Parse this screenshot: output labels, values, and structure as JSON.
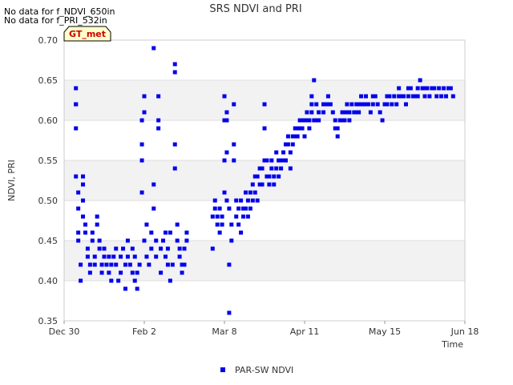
{
  "notes": [
    "No data for f_NDVI_650in",
    "No data for f_PRI_532in"
  ],
  "badge": "GT_met",
  "colors": {
    "series": "#0000ee",
    "band": "#f2f2f2",
    "grid": "#dddddd",
    "badge_bg": "#ffffcc"
  },
  "chart_data": {
    "type": "scatter",
    "title": "SRS NDVI and PRI",
    "xlabel": "Time",
    "ylabel": "NDVI, PRI",
    "ylim": [
      0.35,
      0.7
    ],
    "y_ticks": [
      "0.35",
      "0.40",
      "0.45",
      "0.50",
      "0.55",
      "0.60",
      "0.65",
      "0.70"
    ],
    "x_axis_dates": [
      "Dec 30",
      "Feb 2",
      "Mar 8",
      "Apr 11",
      "May 15",
      "Jun 18"
    ],
    "xlim_days_from_dec30": [
      0,
      170
    ],
    "grid": "horizontal bands",
    "legend": "bottom-center",
    "series": [
      {
        "name": "PAR-SW NDVI",
        "points_day_value": [
          [
            5,
            0.64
          ],
          [
            5,
            0.62
          ],
          [
            5,
            0.62
          ],
          [
            5,
            0.59
          ],
          [
            5,
            0.53
          ],
          [
            6,
            0.51
          ],
          [
            6,
            0.49
          ],
          [
            6,
            0.46
          ],
          [
            6,
            0.45
          ],
          [
            7,
            0.42
          ],
          [
            7,
            0.4
          ],
          [
            8,
            0.53
          ],
          [
            8,
            0.52
          ],
          [
            8,
            0.5
          ],
          [
            8,
            0.48
          ],
          [
            9,
            0.47
          ],
          [
            9,
            0.46
          ],
          [
            10,
            0.44
          ],
          [
            10,
            0.43
          ],
          [
            11,
            0.42
          ],
          [
            11,
            0.41
          ],
          [
            12,
            0.46
          ],
          [
            12,
            0.45
          ],
          [
            13,
            0.43
          ],
          [
            13,
            0.42
          ],
          [
            14,
            0.47
          ],
          [
            14,
            0.48
          ],
          [
            15,
            0.45
          ],
          [
            15,
            0.44
          ],
          [
            16,
            0.42
          ],
          [
            16,
            0.41
          ],
          [
            17,
            0.43
          ],
          [
            17,
            0.44
          ],
          [
            18,
            0.42
          ],
          [
            19,
            0.43
          ],
          [
            19,
            0.41
          ],
          [
            20,
            0.4
          ],
          [
            20,
            0.42
          ],
          [
            21,
            0.43
          ],
          [
            22,
            0.42
          ],
          [
            22,
            0.44
          ],
          [
            23,
            0.4
          ],
          [
            24,
            0.43
          ],
          [
            24,
            0.41
          ],
          [
            25,
            0.44
          ],
          [
            26,
            0.42
          ],
          [
            26,
            0.39
          ],
          [
            27,
            0.43
          ],
          [
            27,
            0.45
          ],
          [
            28,
            0.42
          ],
          [
            29,
            0.41
          ],
          [
            29,
            0.44
          ],
          [
            30,
            0.43
          ],
          [
            30,
            0.4
          ],
          [
            31,
            0.41
          ],
          [
            31,
            0.39
          ],
          [
            32,
            0.42
          ],
          [
            33,
            0.6
          ],
          [
            33,
            0.57
          ],
          [
            33,
            0.55
          ],
          [
            33,
            0.51
          ],
          [
            34,
            0.63
          ],
          [
            34,
            0.61
          ],
          [
            34,
            0.61
          ],
          [
            34,
            0.45
          ],
          [
            35,
            0.47
          ],
          [
            35,
            0.43
          ],
          [
            36,
            0.42
          ],
          [
            37,
            0.46
          ],
          [
            37,
            0.44
          ],
          [
            38,
            0.69
          ],
          [
            38,
            0.52
          ],
          [
            38,
            0.49
          ],
          [
            39,
            0.45
          ],
          [
            39,
            0.43
          ],
          [
            40,
            0.63
          ],
          [
            40,
            0.6
          ],
          [
            40,
            0.59
          ],
          [
            41,
            0.44
          ],
          [
            41,
            0.41
          ],
          [
            42,
            0.45
          ],
          [
            43,
            0.46
          ],
          [
            43,
            0.43
          ],
          [
            44,
            0.44
          ],
          [
            44,
            0.42
          ],
          [
            45,
            0.46
          ],
          [
            45,
            0.4
          ],
          [
            46,
            0.42
          ],
          [
            47,
            0.67
          ],
          [
            47,
            0.66
          ],
          [
            47,
            0.57
          ],
          [
            47,
            0.54
          ],
          [
            48,
            0.47
          ],
          [
            48,
            0.45
          ],
          [
            49,
            0.44
          ],
          [
            49,
            0.43
          ],
          [
            50,
            0.42
          ],
          [
            50,
            0.41
          ],
          [
            51,
            0.44
          ],
          [
            51,
            0.42
          ],
          [
            52,
            0.45
          ],
          [
            52,
            0.46
          ],
          [
            63,
            0.48
          ],
          [
            63,
            0.44
          ],
          [
            64,
            0.5
          ],
          [
            64,
            0.49
          ],
          [
            65,
            0.48
          ],
          [
            65,
            0.47
          ],
          [
            66,
            0.49
          ],
          [
            66,
            0.46
          ],
          [
            67,
            0.48
          ],
          [
            67,
            0.47
          ],
          [
            68,
            0.63
          ],
          [
            68,
            0.6
          ],
          [
            68,
            0.55
          ],
          [
            68,
            0.51
          ],
          [
            69,
            0.61
          ],
          [
            69,
            0.6
          ],
          [
            69,
            0.56
          ],
          [
            69,
            0.5
          ],
          [
            70,
            0.49
          ],
          [
            70,
            0.42
          ],
          [
            70,
            0.36
          ],
          [
            71,
            0.45
          ],
          [
            71,
            0.47
          ],
          [
            72,
            0.62
          ],
          [
            72,
            0.57
          ],
          [
            72,
            0.55
          ],
          [
            73,
            0.48
          ],
          [
            73,
            0.5
          ],
          [
            74,
            0.49
          ],
          [
            74,
            0.47
          ],
          [
            75,
            0.5
          ],
          [
            75,
            0.46
          ],
          [
            76,
            0.48
          ],
          [
            76,
            0.49
          ],
          [
            77,
            0.49
          ],
          [
            77,
            0.51
          ],
          [
            78,
            0.48
          ],
          [
            78,
            0.5
          ],
          [
            79,
            0.51
          ],
          [
            79,
            0.49
          ],
          [
            80,
            0.52
          ],
          [
            80,
            0.5
          ],
          [
            81,
            0.53
          ],
          [
            81,
            0.51
          ],
          [
            82,
            0.53
          ],
          [
            82,
            0.5
          ],
          [
            83,
            0.52
          ],
          [
            83,
            0.54
          ],
          [
            84,
            0.54
          ],
          [
            84,
            0.52
          ],
          [
            85,
            0.62
          ],
          [
            85,
            0.59
          ],
          [
            85,
            0.55
          ],
          [
            86,
            0.53
          ],
          [
            86,
            0.55
          ],
          [
            87,
            0.53
          ],
          [
            87,
            0.52
          ],
          [
            88,
            0.54
          ],
          [
            88,
            0.55
          ],
          [
            89,
            0.53
          ],
          [
            89,
            0.52
          ],
          [
            90,
            0.54
          ],
          [
            90,
            0.56
          ],
          [
            91,
            0.55
          ],
          [
            91,
            0.53
          ],
          [
            92,
            0.55
          ],
          [
            92,
            0.54
          ],
          [
            93,
            0.56
          ],
          [
            93,
            0.55
          ],
          [
            94,
            0.57
          ],
          [
            94,
            0.55
          ],
          [
            95,
            0.58
          ],
          [
            95,
            0.57
          ],
          [
            96,
            0.56
          ],
          [
            96,
            0.54
          ],
          [
            97,
            0.58
          ],
          [
            97,
            0.57
          ],
          [
            98,
            0.58
          ],
          [
            98,
            0.59
          ],
          [
            99,
            0.59
          ],
          [
            99,
            0.58
          ],
          [
            100,
            0.6
          ],
          [
            100,
            0.59
          ],
          [
            101,
            0.6
          ],
          [
            101,
            0.59
          ],
          [
            102,
            0.6
          ],
          [
            102,
            0.58
          ],
          [
            103,
            0.61
          ],
          [
            103,
            0.6
          ],
          [
            104,
            0.6
          ],
          [
            104,
            0.59
          ],
          [
            105,
            0.63
          ],
          [
            105,
            0.62
          ],
          [
            105,
            0.61
          ],
          [
            106,
            0.65
          ],
          [
            106,
            0.6
          ],
          [
            107,
            0.62
          ],
          [
            107,
            0.6
          ],
          [
            108,
            0.61
          ],
          [
            108,
            0.6
          ],
          [
            110,
            0.62
          ],
          [
            110,
            0.61
          ],
          [
            111,
            0.62
          ],
          [
            112,
            0.63
          ],
          [
            112,
            0.62
          ],
          [
            113,
            0.62
          ],
          [
            114,
            0.61
          ],
          [
            115,
            0.6
          ],
          [
            115,
            0.59
          ],
          [
            116,
            0.59
          ],
          [
            116,
            0.58
          ],
          [
            117,
            0.6
          ],
          [
            118,
            0.61
          ],
          [
            118,
            0.6
          ],
          [
            119,
            0.61
          ],
          [
            119,
            0.6
          ],
          [
            120,
            0.62
          ],
          [
            120,
            0.61
          ],
          [
            121,
            0.61
          ],
          [
            121,
            0.6
          ],
          [
            122,
            0.62
          ],
          [
            123,
            0.61
          ],
          [
            124,
            0.62
          ],
          [
            124,
            0.61
          ],
          [
            125,
            0.62
          ],
          [
            125,
            0.61
          ],
          [
            126,
            0.62
          ],
          [
            126,
            0.63
          ],
          [
            127,
            0.62
          ],
          [
            128,
            0.63
          ],
          [
            128,
            0.62
          ],
          [
            129,
            0.62
          ],
          [
            130,
            0.61
          ],
          [
            131,
            0.63
          ],
          [
            131,
            0.62
          ],
          [
            132,
            0.63
          ],
          [
            133,
            0.62
          ],
          [
            134,
            0.61
          ],
          [
            135,
            0.6
          ],
          [
            136,
            0.62
          ],
          [
            137,
            0.62
          ],
          [
            137,
            0.63
          ],
          [
            138,
            0.63
          ],
          [
            139,
            0.62
          ],
          [
            140,
            0.63
          ],
          [
            141,
            0.62
          ],
          [
            142,
            0.63
          ],
          [
            142,
            0.64
          ],
          [
            143,
            0.63
          ],
          [
            144,
            0.63
          ],
          [
            145,
            0.62
          ],
          [
            146,
            0.63
          ],
          [
            146,
            0.64
          ],
          [
            147,
            0.64
          ],
          [
            148,
            0.63
          ],
          [
            149,
            0.63
          ],
          [
            150,
            0.64
          ],
          [
            150,
            0.63
          ],
          [
            151,
            0.65
          ],
          [
            152,
            0.64
          ],
          [
            153,
            0.63
          ],
          [
            153,
            0.64
          ],
          [
            154,
            0.64
          ],
          [
            155,
            0.63
          ],
          [
            156,
            0.64
          ],
          [
            157,
            0.64
          ],
          [
            158,
            0.63
          ],
          [
            159,
            0.64
          ],
          [
            160,
            0.63
          ],
          [
            161,
            0.64
          ],
          [
            162,
            0.63
          ],
          [
            163,
            0.64
          ],
          [
            164,
            0.64
          ],
          [
            165,
            0.63
          ]
        ]
      }
    ]
  }
}
